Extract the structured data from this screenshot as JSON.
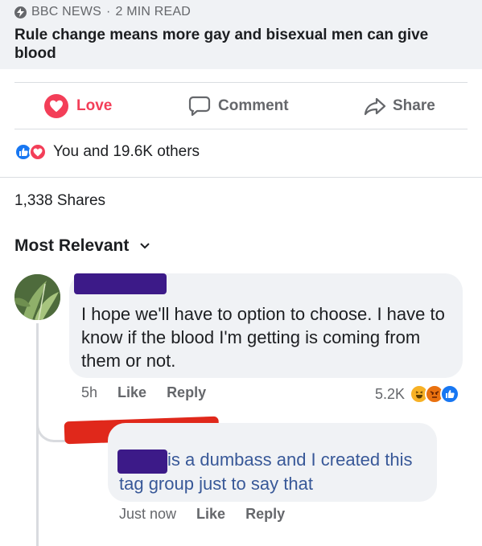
{
  "link_preview": {
    "source": "BBC NEWS",
    "dot": "·",
    "read_time": "2 MIN READ",
    "headline": "Rule change means more gay and bisexual men can give blood"
  },
  "actions": {
    "love": "Love",
    "comment": "Comment",
    "share": "Share"
  },
  "reactions": {
    "summary": "You and 19.6K others"
  },
  "shares": "1,338 Shares",
  "sort": {
    "label": "Most Relevant"
  },
  "comment": {
    "text": "I hope we'll have to option to choose. I have to know if the blood I'm getting is coming from them or not.",
    "time": "5h",
    "like": "Like",
    "reply": "Reply",
    "reaction_count": "5.2K"
  },
  "reply": {
    "text_line1": "is a dumbass and I created this",
    "text_line2": "tag group just to say that",
    "time": "Just now",
    "like": "Like",
    "reply": "Reply"
  },
  "colors": {
    "love": "#f33e58",
    "link": "#385898",
    "secondary": "#65676b",
    "redact_purple": "#3c1a88",
    "redact_red": "#e0281b"
  }
}
